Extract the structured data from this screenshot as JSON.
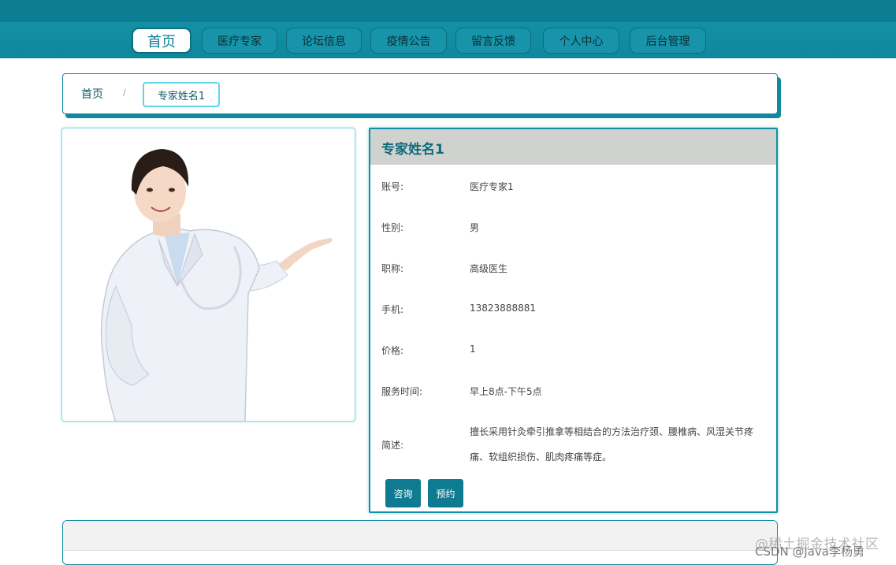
{
  "nav": {
    "items": [
      {
        "label": "首页",
        "active": true
      },
      {
        "label": "医疗专家",
        "active": false
      },
      {
        "label": "论坛信息",
        "active": false
      },
      {
        "label": "疫情公告",
        "active": false
      },
      {
        "label": "留言反馈",
        "active": false
      },
      {
        "label": "个人中心",
        "active": false
      },
      {
        "label": "后台管理",
        "active": false
      }
    ]
  },
  "breadcrumb": {
    "home": "首页",
    "separator": "/",
    "current": "专家姓名1"
  },
  "detail": {
    "title": "专家姓名1",
    "fields": [
      {
        "label": "账号:",
        "value": "医疗专家1"
      },
      {
        "label": "性别:",
        "value": "男"
      },
      {
        "label": "职称:",
        "value": "高级医生"
      },
      {
        "label": "手机:",
        "value": "13823888881"
      },
      {
        "label": "价格:",
        "value": "1"
      },
      {
        "label": "服务时间:",
        "value": "早上8点-下午5点"
      }
    ],
    "description_label": "简述:",
    "description": "擅长采用针灸牵引推拿等相结合的方法治疗颈、腰椎病、风湿关节疼痛、软组织损伤、肌肉疼痛等症。",
    "consult_label": "咨询",
    "book_label": "预约"
  },
  "watermark": {
    "line1": "@稀土掘金技术社区",
    "line2": "CSDN @java李杨勇"
  },
  "colors": {
    "accent": "#148fa4",
    "button": "#0f7b91",
    "header_bg": "#cfd2cf"
  }
}
